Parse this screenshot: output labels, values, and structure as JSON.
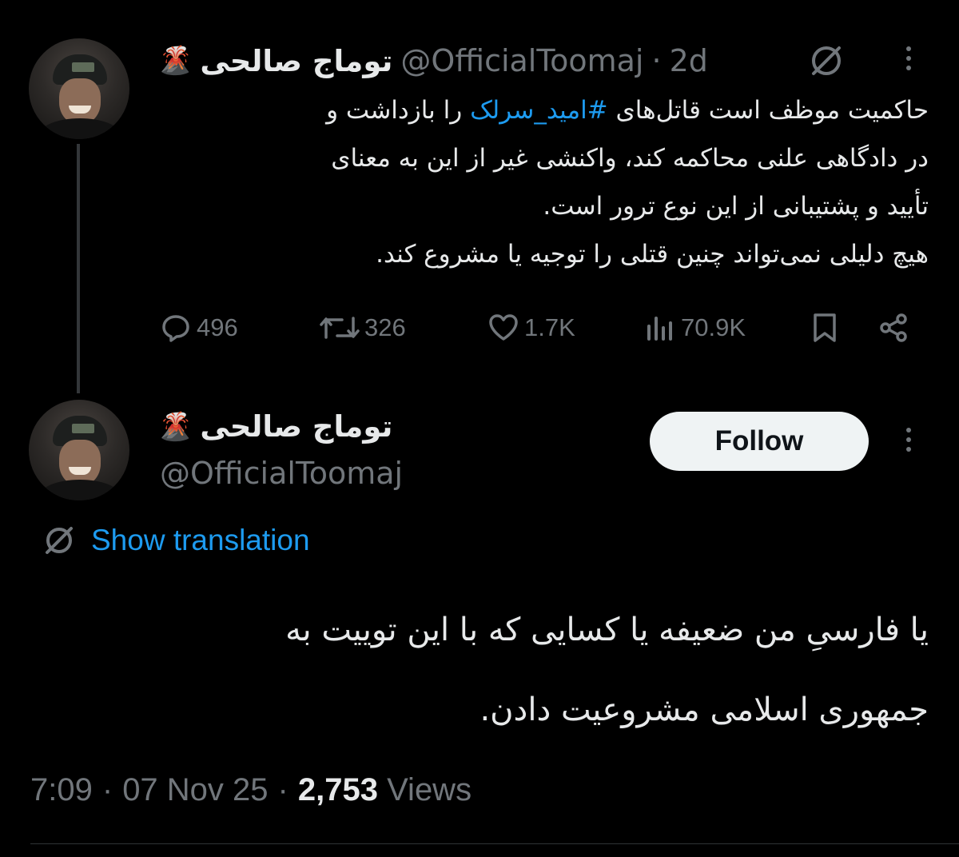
{
  "reply_to_tweet": {
    "author": {
      "display_name": "توماج صالحی",
      "name_emoji": "🌋",
      "handle": "@OfficialToomaj"
    },
    "separator": "·",
    "age": "2d",
    "icons": {
      "translate": "translate-icon",
      "more": "more-icon"
    },
    "text_lines": [
      {
        "before": "حاکمیت موظف است قاتل‌های ",
        "hashtag": "#امید_سرلک",
        "after": " را بازداشت و"
      },
      "در دادگاهی علنی محاکمه کند، واکنشی غیر از این به معنای",
      "تأیید و پشتیبانی از این نوع ترور است.",
      "هیچ دلیلی نمی‌تواند چنین قتلی را توجیه یا مشروع کند."
    ],
    "actions": {
      "replies": "496",
      "reposts": "326",
      "likes": "1.7K",
      "views": "70.9K",
      "icons": [
        "reply-icon",
        "repost-icon",
        "like-icon",
        "views-icon",
        "bookmark-icon",
        "share-icon"
      ]
    }
  },
  "main_tweet": {
    "author": {
      "display_name": "توماج صالحی",
      "name_emoji": "🌋",
      "handle": "@OfficialToomaj"
    },
    "follow_label": "Follow",
    "show_translation": "Show translation",
    "text_lines": [
      "یا فارسیِ من ضعیفه یا کسایی که با این توییت به",
      "جمهوری اسلامی مشروعیت دادن."
    ],
    "time": "7:09",
    "date": "07 Nov 25",
    "separator": "·",
    "views_count": "2,753",
    "views_label": "Views"
  },
  "colors": {
    "background": "#000000",
    "text": "#e7e9ea",
    "secondary": "#71767b",
    "link": "#1d9bf0"
  }
}
